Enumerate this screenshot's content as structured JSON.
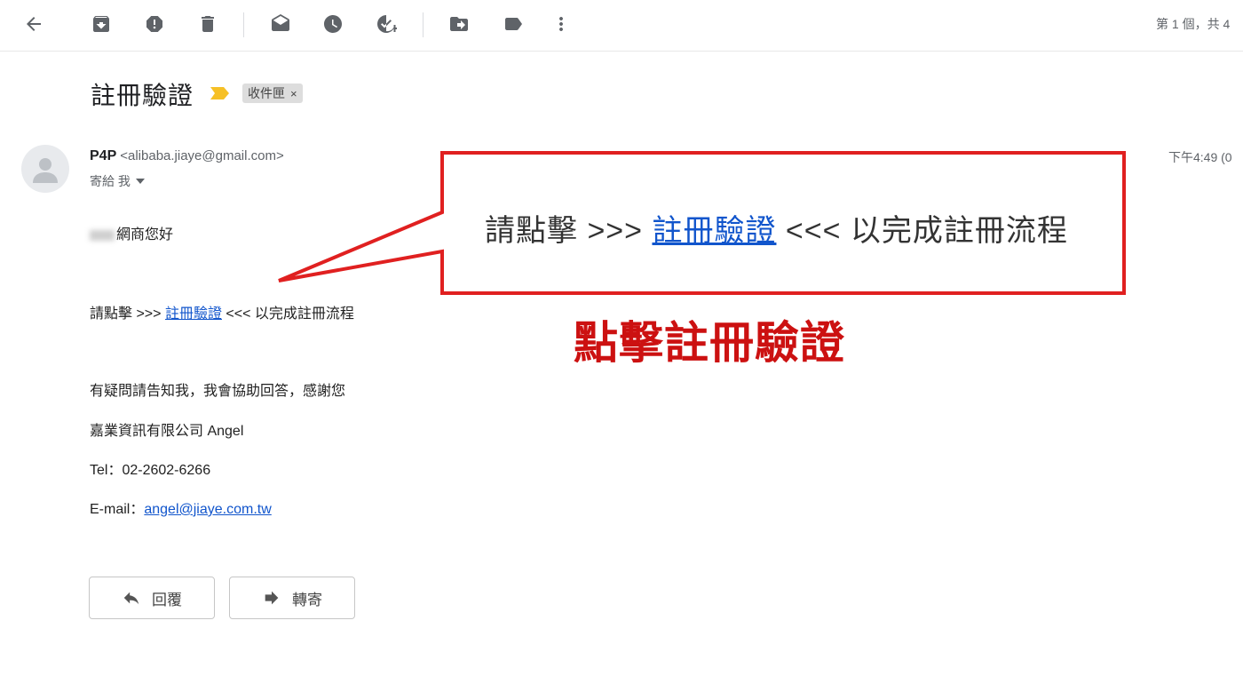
{
  "toolbar": {
    "icons": [
      "back-arrow-icon",
      "archive-icon",
      "report-spam-icon",
      "delete-icon",
      "mark-unread-icon",
      "snooze-icon",
      "add-task-icon",
      "move-to-icon",
      "label-icon",
      "more-vert-icon"
    ],
    "pager": "第 1 個，共 4"
  },
  "subject": "註冊驗證",
  "label_chip": {
    "label": "收件匣",
    "remove": "×"
  },
  "sender": {
    "name": "P4P",
    "email": "<alibaba.jiaye@gmail.com>",
    "to": "寄給 我",
    "time": "下午4:49 (0"
  },
  "body": {
    "greeting": "網商您好",
    "line_prefix": "請點擊 >>> ",
    "link": "註冊驗證",
    "line_suffix": " <<< 以完成註冊流程",
    "question": "有疑問請告知我，我會協助回答，感謝您",
    "company": "嘉業資訊有限公司 Angel",
    "tel": "Tel：02-2602-6266",
    "email_label": "E-mail：",
    "email_link": "angel@jiaye.com.tw"
  },
  "actions": {
    "reply": "回覆",
    "forward": "轉寄"
  },
  "callout": {
    "prefix": "請點擊 >>> ",
    "link": "註冊驗證",
    "suffix": " <<< 以完成註冊流程",
    "note": "點擊註冊驗證",
    "border_color": "#e02020",
    "note_color": "#cc1111"
  }
}
